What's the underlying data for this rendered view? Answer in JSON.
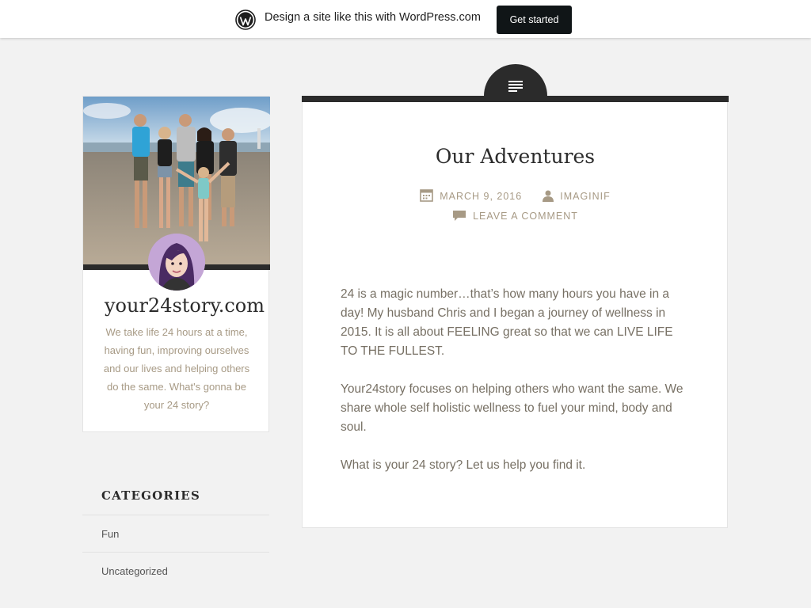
{
  "banner": {
    "text": "Design a site like this with WordPress.com",
    "cta_label": "Get started"
  },
  "site": {
    "title": "your24story.com",
    "description": "We take life 24 hours at a time, having fun, improving ourselves and our lives and helping others do the same. What's gonna be your 24 story?"
  },
  "categories": {
    "title": "CATEGORIES",
    "items": [
      {
        "label": "Fun"
      },
      {
        "label": "Uncategorized"
      }
    ]
  },
  "post": {
    "title": "Our Adventures",
    "date": "MARCH 9, 2016",
    "author": "IMAGINIF",
    "comment_link": "LEAVE A COMMENT",
    "paragraphs": [
      "24 is a magic number…that’s how many hours you have in a day! My husband Chris and I began a journey of wellness in 2015. It is all about FEELING great so that we can LIVE LIFE TO THE FULLEST.",
      "Your24story focuses on helping others who want the same. We share whole self holistic wellness to fuel your mind, body and soul.",
      "What is your 24 story? Let us help you find it."
    ]
  },
  "icons": {
    "banner_logo": "wordpress-logo-icon",
    "post_format": "standard-format-icon",
    "date": "calendar-icon",
    "author": "person-icon",
    "comment": "comment-bubble-icon"
  },
  "colors": {
    "accent_dark": "#2b2b2b",
    "meta_text": "#a79a85",
    "body_text": "#777064",
    "page_bg": "#f2f2f2"
  }
}
